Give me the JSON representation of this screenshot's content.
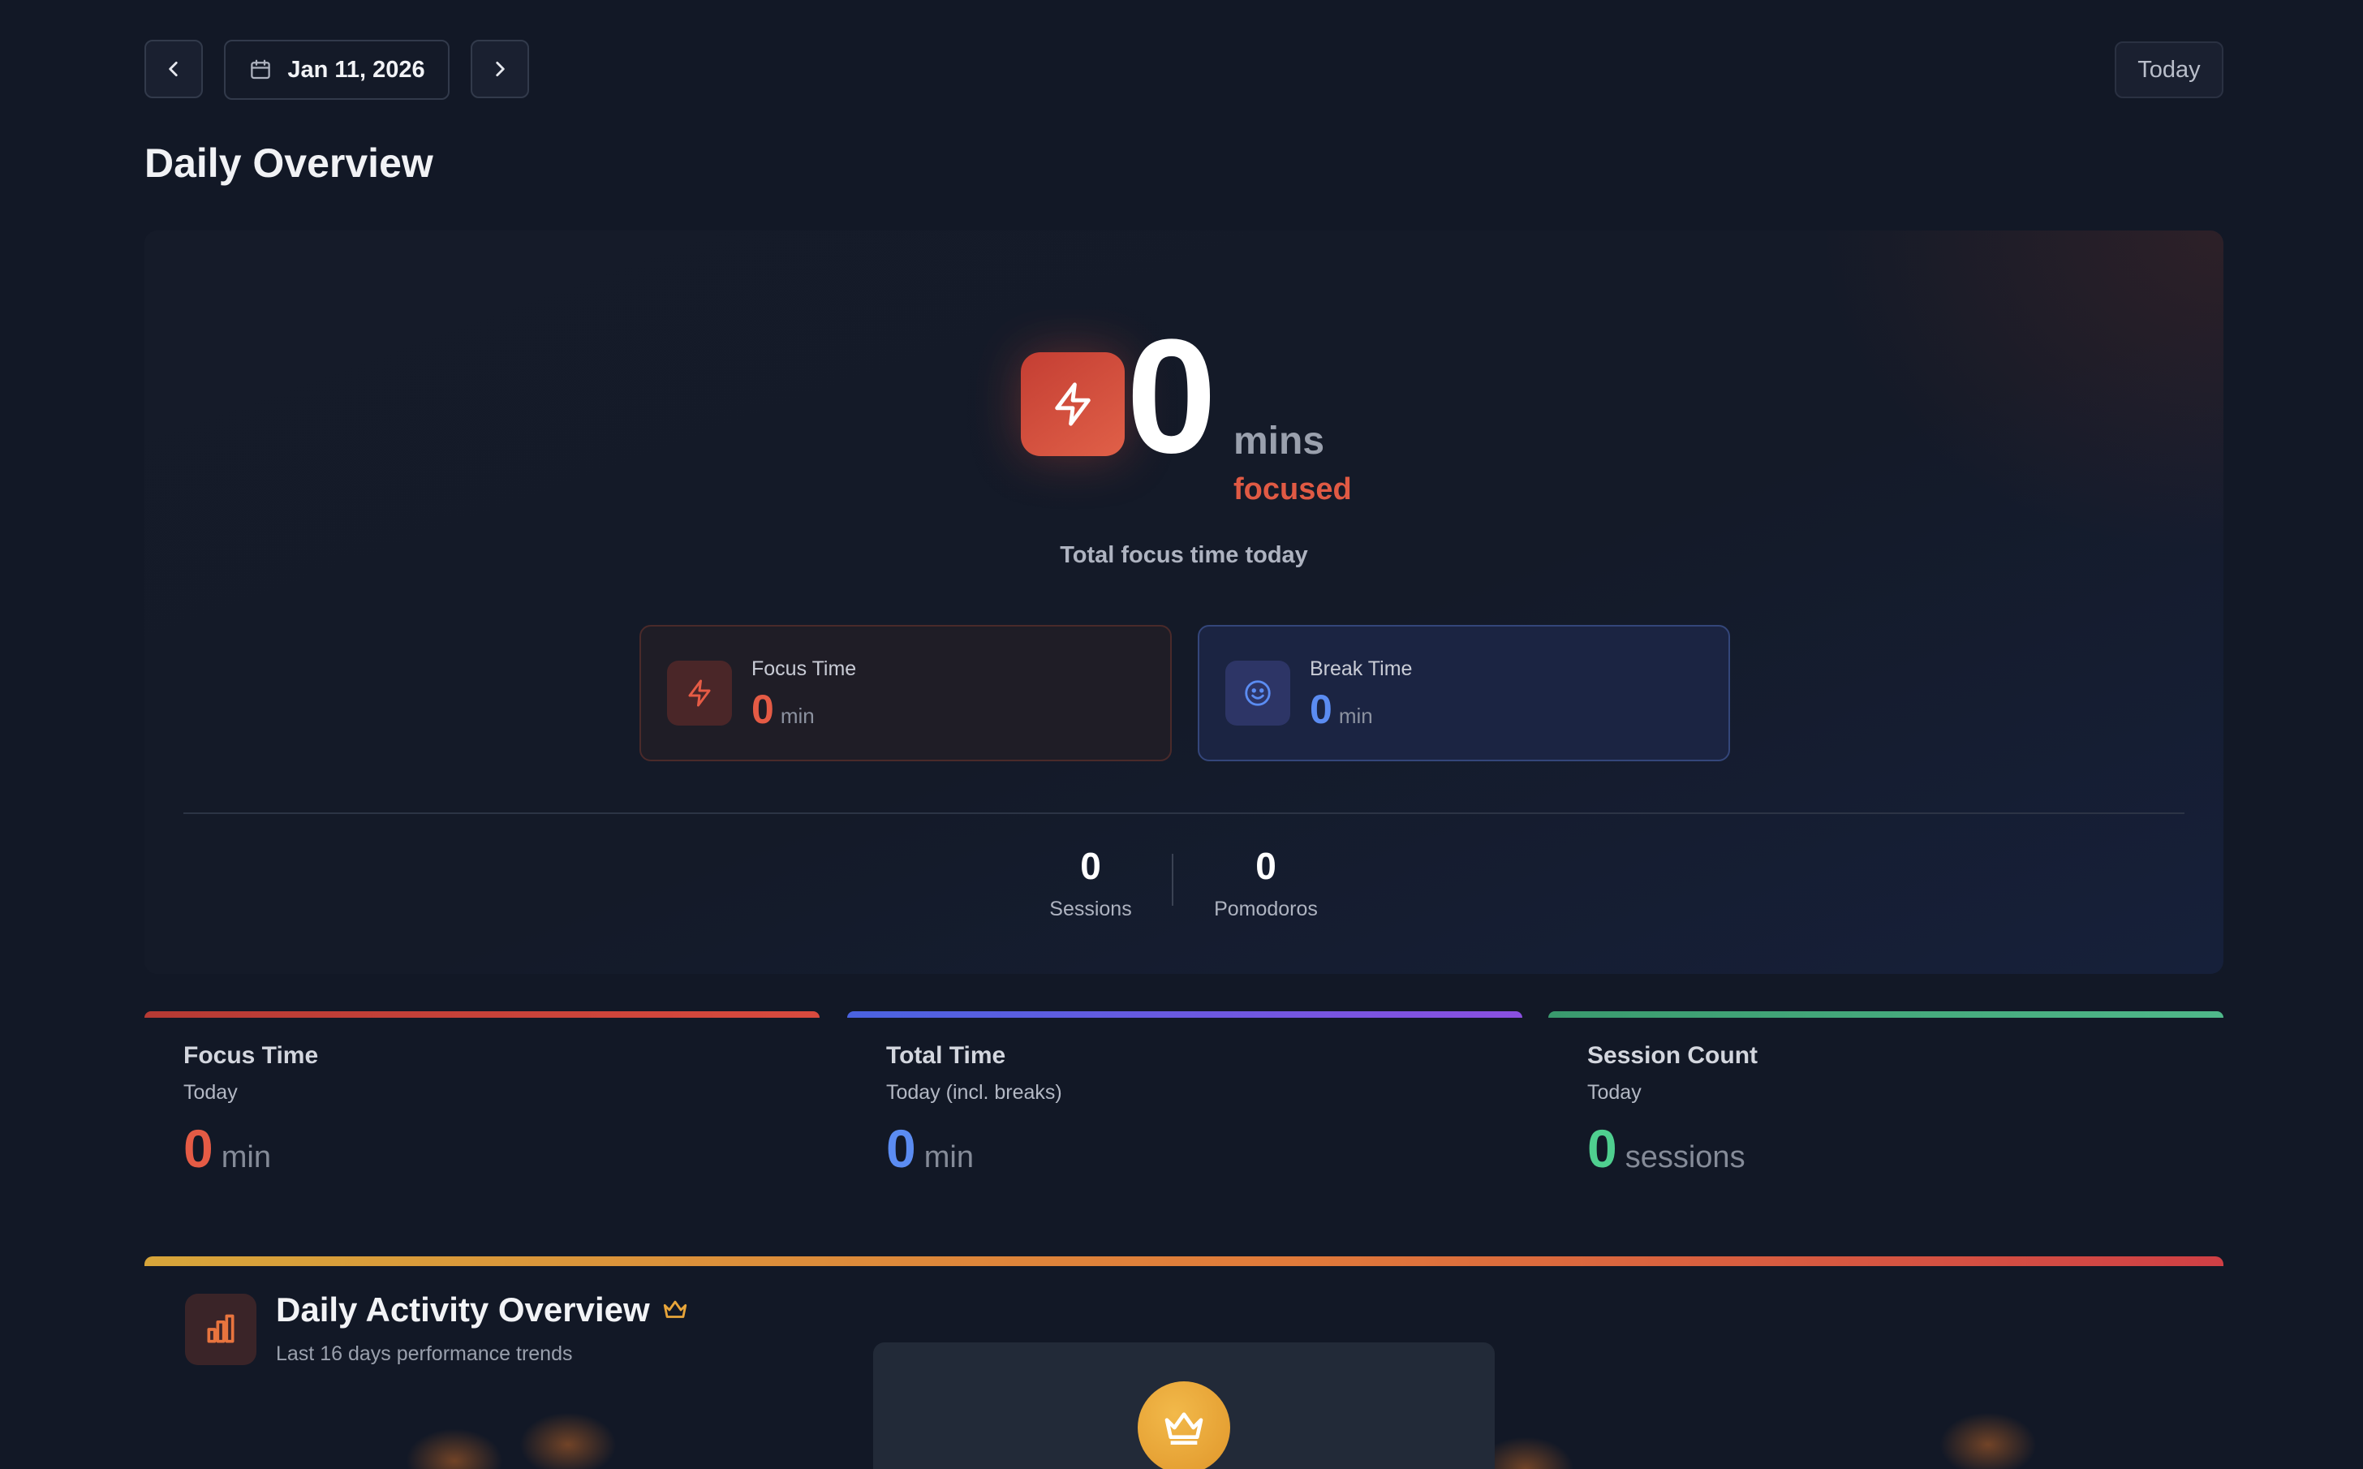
{
  "header": {
    "prev_icon": "chevron-left-icon",
    "next_icon": "chevron-right-icon",
    "calendar_icon": "calendar-icon",
    "date_label": "Jan 11, 2026",
    "today_label": "Today"
  },
  "page_title": "Daily Overview",
  "hero": {
    "icon": "lightning-icon",
    "total_value": "0",
    "unit": "mins",
    "status": "focused",
    "caption": "Total focus time today",
    "focus_card": {
      "icon": "lightning-icon",
      "label": "Focus Time",
      "value": "0",
      "unit": "min"
    },
    "break_card": {
      "icon": "smiley-icon",
      "label": "Break Time",
      "value": "0",
      "unit": "min"
    },
    "stats": [
      {
        "value": "0",
        "label": "Sessions"
      },
      {
        "value": "0",
        "label": "Pomodoros"
      }
    ]
  },
  "metrics": [
    {
      "title": "Focus Time",
      "subtitle": "Today",
      "value": "0",
      "unit": "min",
      "color": "#e55b45"
    },
    {
      "title": "Total Time",
      "subtitle": "Today (incl. breaks)",
      "value": "0",
      "unit": "min",
      "color": "#5b8cf2"
    },
    {
      "title": "Session Count",
      "subtitle": "Today",
      "value": "0",
      "unit": "sessions",
      "color": "#4fcf8f"
    }
  ],
  "activity": {
    "icon": "bar-chart-icon",
    "title": "Daily Activity Overview",
    "title_icon": "crown-icon",
    "subtitle": "Last 16 days performance trends",
    "badge_icon": "crown-icon"
  },
  "colors": {
    "background": "#121826",
    "focus": "#e55b45",
    "break": "#5b8cf2",
    "sessions": "#4fcf8f"
  }
}
